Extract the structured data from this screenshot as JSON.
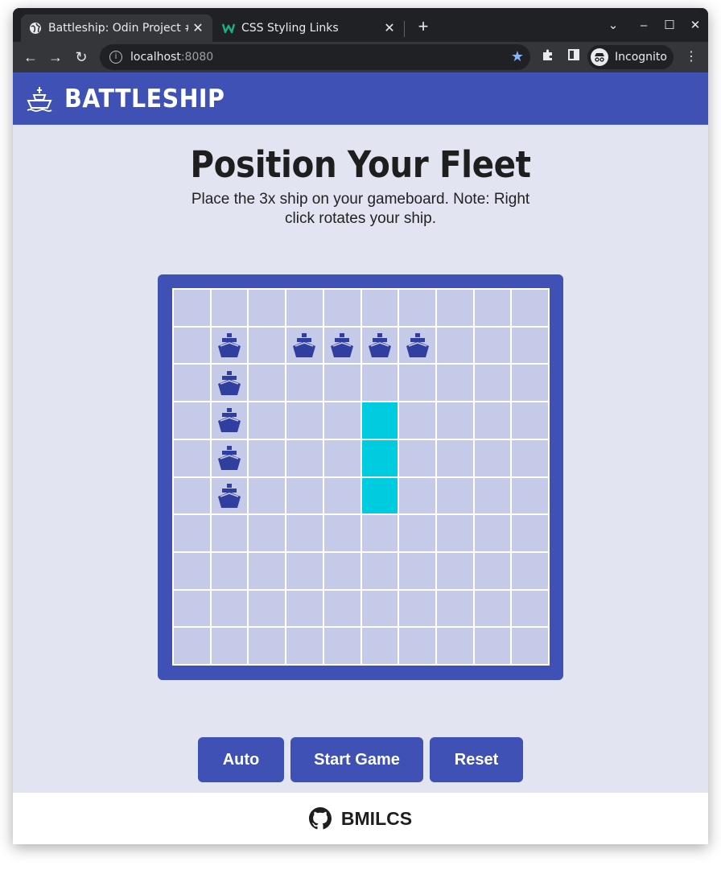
{
  "browser": {
    "tabs": [
      {
        "title": "Battleship: Odin Project #",
        "active": true
      },
      {
        "title": "CSS Styling Links",
        "active": false
      }
    ],
    "address": {
      "host": "localhost",
      "port": ":8080"
    },
    "profile_label": "Incognito"
  },
  "app": {
    "title": "BATTLESHIP",
    "brand_color": "#3f51b5",
    "page_bg": "#e3e4f1"
  },
  "placement": {
    "heading": "Position Your Fleet",
    "instructions": "Place the 3x ship on your gameboard. Note: Right click rotates your ship."
  },
  "board": {
    "rows": 10,
    "cols": 10,
    "cell_color": "#c5cae9",
    "preview_color": "#00cce0",
    "ship_color": "#303f9f",
    "ship_cells": [
      [
        1,
        1
      ],
      [
        2,
        1
      ],
      [
        3,
        1
      ],
      [
        4,
        1
      ],
      [
        5,
        1
      ],
      [
        1,
        3
      ],
      [
        1,
        4
      ],
      [
        1,
        5
      ],
      [
        1,
        6
      ]
    ],
    "preview_cells": [
      [
        3,
        5
      ],
      [
        4,
        5
      ],
      [
        5,
        5
      ]
    ]
  },
  "buttons": {
    "auto": "Auto",
    "start": "Start Game",
    "reset": "Reset"
  },
  "footer": {
    "author": "BMILCS"
  }
}
